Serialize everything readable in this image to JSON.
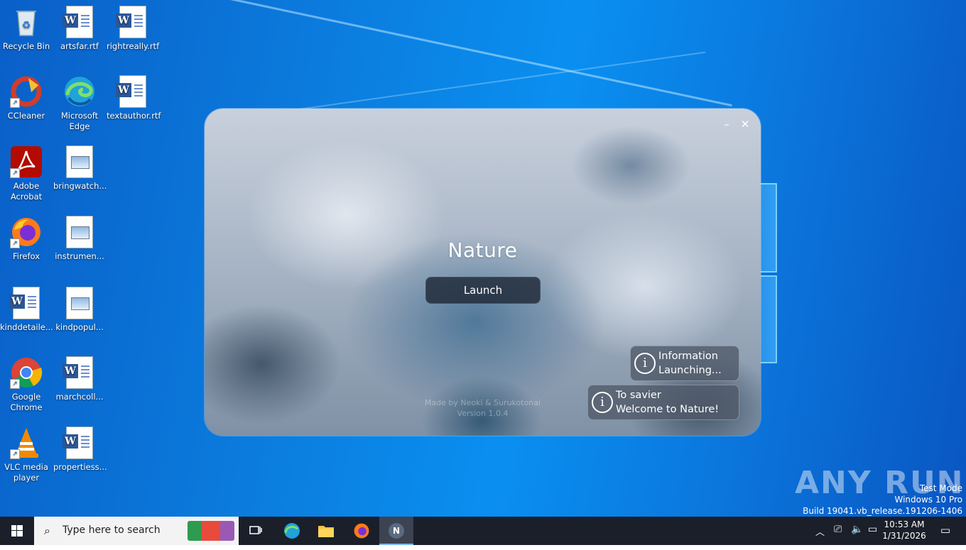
{
  "desktop": {
    "icons": [
      {
        "label": "Recycle Bin"
      },
      {
        "label": "artsfar.rtf"
      },
      {
        "label": "rightreally.rtf"
      },
      {
        "label": "CCleaner"
      },
      {
        "label": "Microsoft Edge"
      },
      {
        "label": "textauthor.rtf"
      },
      {
        "label": "Adobe Acrobat"
      },
      {
        "label": "bringwatch..."
      },
      {
        "label": "Firefox"
      },
      {
        "label": "instrumen..."
      },
      {
        "label": "kinddetaile..."
      },
      {
        "label": "kindpopul..."
      },
      {
        "label": "Google Chrome"
      },
      {
        "label": "marchcoll..."
      },
      {
        "label": "VLC media player"
      },
      {
        "label": "propertiess..."
      }
    ]
  },
  "app": {
    "title": "Nature",
    "launch_label": "Launch",
    "credit_line1": "Made by Neoki & Surukotonai",
    "credit_line2": "Version 1.0.4",
    "minimize_glyph": "–",
    "close_glyph": "✕",
    "toasts": [
      {
        "title": "Information",
        "message": "Launching..."
      },
      {
        "title": "To savier",
        "message": "Welcome to Nature!"
      }
    ]
  },
  "watermark": {
    "brand": "ANY RUN",
    "line1": "Test Mode",
    "line2": "Windows 10 Pro",
    "line3": "Build 19041.vb_release.191206-1406"
  },
  "taskbar": {
    "search_placeholder": "Type here to search",
    "clock_time": "10:53 AM",
    "clock_date": "1/31/2026",
    "running_app_letter": "N"
  },
  "colors": {
    "desktop_blue": "#0b7fe0",
    "taskbar": "#1b1f2a"
  }
}
